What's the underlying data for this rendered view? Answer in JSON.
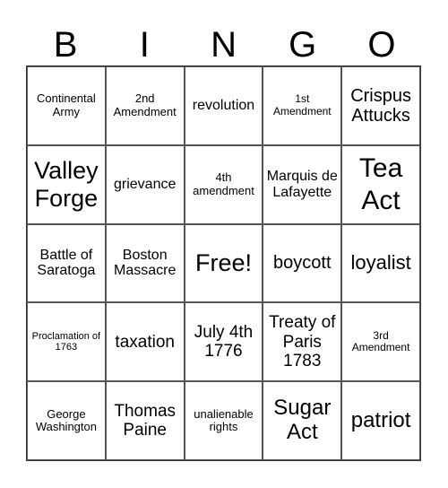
{
  "header": {
    "letters": [
      "B",
      "I",
      "N",
      "G",
      "O"
    ]
  },
  "cells": [
    [
      "Continental Army",
      "2nd Amendment",
      "revolution",
      "1st Amendment",
      "Crispus Attucks"
    ],
    [
      "Valley Forge",
      "grievance",
      "4th amendment",
      "Marquis de Lafayette",
      "Tea Act"
    ],
    [
      "Battle of Saratoga",
      "Boston Massacre",
      "Free!",
      "boycott",
      "loyalist"
    ],
    [
      "Proclamation of 1763",
      "taxation",
      "July 4th 1776",
      "Treaty of Paris 1783",
      "3rd Amendment"
    ],
    [
      "George Washington",
      "Thomas Paine",
      "unalienable rights",
      "Sugar Act",
      "patriot"
    ]
  ]
}
